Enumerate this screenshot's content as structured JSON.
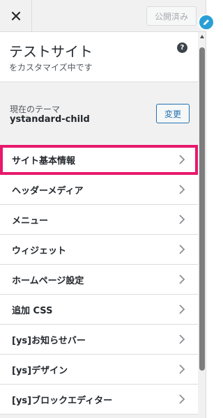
{
  "header": {
    "publish_label": "公開済み"
  },
  "site": {
    "title": "テストサイト",
    "subtitle": "をカスタマイズ中です"
  },
  "theme": {
    "label": "現在のテーマ",
    "name": "ystandard-child",
    "change_label": "変更"
  },
  "menu": {
    "items": [
      {
        "label": "サイト基本情報"
      },
      {
        "label": "ヘッダーメディア"
      },
      {
        "label": "メニュー"
      },
      {
        "label": "ウィジェット"
      },
      {
        "label": "ホームページ設定"
      },
      {
        "label": "追加 CSS"
      },
      {
        "label": "[ys]お知らせバー"
      },
      {
        "label": "[ys]デザイン"
      },
      {
        "label": "[ys]ブロックエディター"
      }
    ]
  },
  "icons": {
    "close": "close-icon",
    "help": "help-icon",
    "chevron": "chevron-right-icon",
    "edit": "pencil-icon"
  },
  "colors": {
    "highlight": "#e8186d",
    "accent": "#2271b1",
    "edit_shortcut": "#2a9fd6"
  }
}
